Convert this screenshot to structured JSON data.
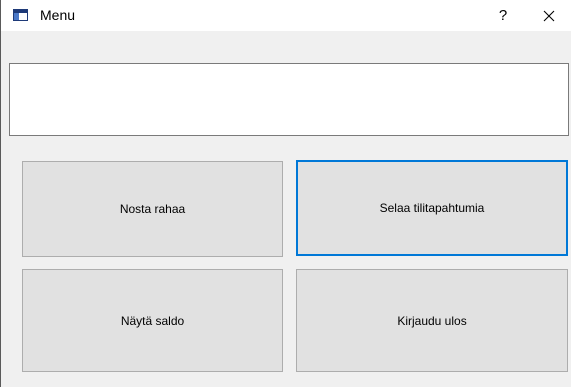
{
  "window": {
    "title": "Menu",
    "help_label": "?",
    "close_icon": "close-icon",
    "app_icon": "window-app-icon"
  },
  "display": {
    "value": ""
  },
  "buttons": {
    "withdraw": "Nosta rahaa",
    "transactions": "Selaa tilitapahtumia",
    "balance": "Näytä saldo",
    "logout": "Kirjaudu ulos"
  },
  "colors": {
    "focus_border": "#0078d7",
    "button_face": "#e1e1e1",
    "window_bg": "#f0f0f0"
  }
}
